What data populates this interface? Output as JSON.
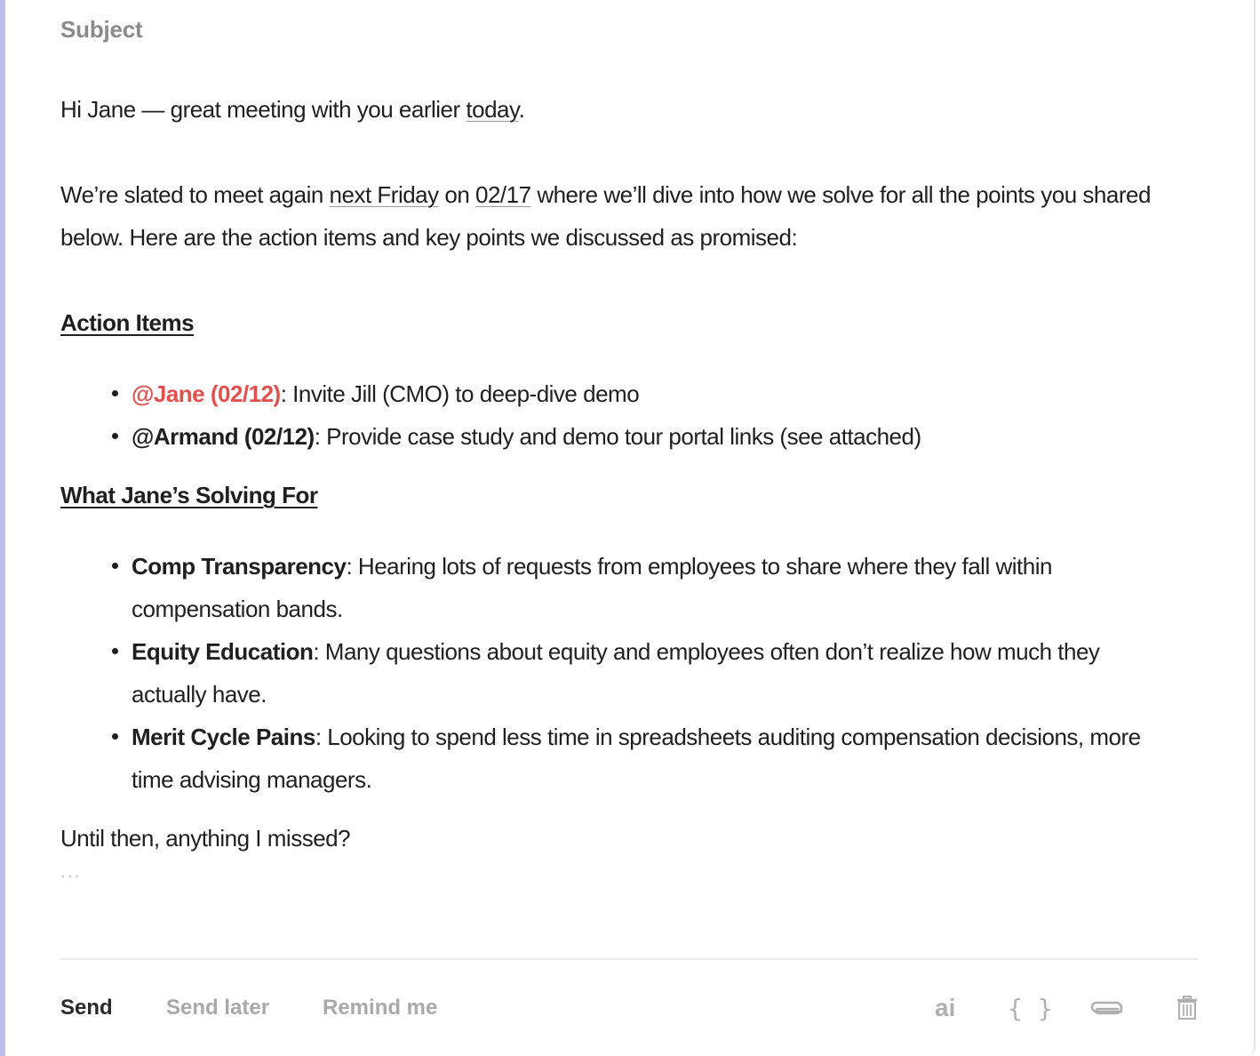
{
  "compose": {
    "subject_placeholder": "Subject",
    "greeting": {
      "before": "Hi Jane — great meeting with you earlier ",
      "link": "today",
      "after": "."
    },
    "intro": {
      "part1": "We’re slated to meet again ",
      "link1": "next Friday",
      "part2": " on ",
      "link2": "02/17",
      "part3": " where we’ll dive into how we solve for all the points you shared below. Here are the action items and key points we discussed as promised:"
    },
    "action_items": {
      "heading": "Action Items",
      "items": [
        {
          "mention": "@Jane (02/12)",
          "text": ": Invite Jill (CMO) to deep-dive demo",
          "highlight": true
        },
        {
          "mention": "@Armand (02/12)",
          "text": ": Provide case study and demo tour portal links (see attached)",
          "highlight": false
        }
      ]
    },
    "solving_for": {
      "heading": "What Jane’s Solving For",
      "items": [
        {
          "title": "Comp Transparency",
          "text": ": Hearing lots of requests from employees to share where they fall within compensation bands."
        },
        {
          "title": "Equity Education",
          "text": ": Many questions about equity and employees often don’t realize how much they actually have."
        },
        {
          "title": "Merit Cycle Pains",
          "text": ": Looking to spend less time in spreadsheets auditing compensation decisions, more time advising managers."
        }
      ]
    },
    "closing": "Until then, anything I missed?",
    "trimmed_content": "···"
  },
  "toolbar": {
    "send_label": "Send",
    "send_later_label": "Send later",
    "remind_me_label": "Remind me",
    "ai_label": "ai",
    "snippets_label": "{ }",
    "icons": [
      "ai-icon",
      "braces-icon",
      "paperclip-icon",
      "trash-icon"
    ]
  },
  "colors": {
    "accent_bar": "#bdbfe6",
    "mention_highlight": "#e0514e",
    "text": "#1f1f1f",
    "muted": "#a9a9a9"
  }
}
